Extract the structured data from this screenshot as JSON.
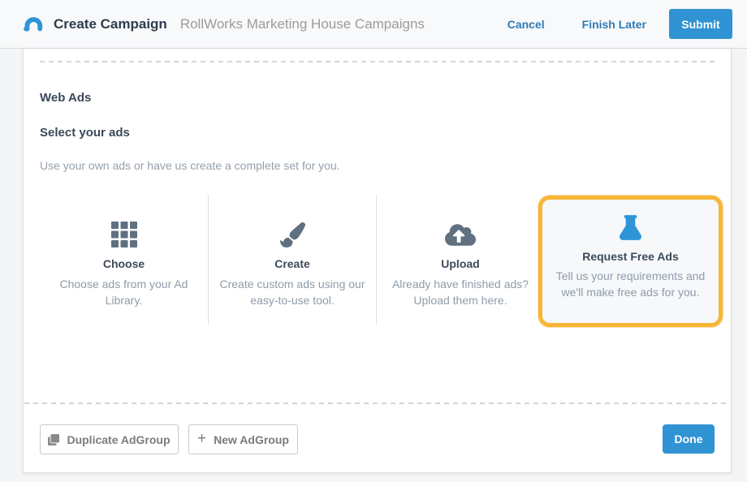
{
  "header": {
    "title": "Create Campaign",
    "subtitle": "RollWorks Marketing House Campaigns",
    "cancel_label": "Cancel",
    "finish_later_label": "Finish Later",
    "submit_label": "Submit"
  },
  "content": {
    "section_title": "Web Ads",
    "subsection_title": "Select your ads",
    "description": "Use your own ads or have us create a complete set for you.",
    "options": [
      {
        "icon": "grid-icon",
        "title": "Choose",
        "description": "Choose ads from your Ad Library.",
        "selected": false
      },
      {
        "icon": "paint-brush-icon",
        "title": "Create",
        "description": "Create custom ads using our easy-to-use tool.",
        "selected": false
      },
      {
        "icon": "cloud-upload-icon",
        "title": "Upload",
        "description": "Already have finished ads? Upload them here.",
        "selected": false
      },
      {
        "icon": "flask-icon",
        "title": "Request Free Ads",
        "description": "Tell us your requirements and we'll make free ads for you.",
        "selected": true
      }
    ]
  },
  "footer": {
    "duplicate_label": "Duplicate AdGroup",
    "new_label": "New AdGroup",
    "plus_glyph": "+",
    "done_label": "Done"
  },
  "icons": {
    "logo": "rollworks-swoosh-icon",
    "duplicate": "copy-icon",
    "new": "plus-icon"
  },
  "colors": {
    "accent_blue": "#3093d3",
    "link_blue": "#2d7cb7",
    "highlight_orange": "#f7b636",
    "icon_gray": "#5f7080",
    "flask_blue": "#2e95d8",
    "heading": "#3b4a5a",
    "muted_text": "#8e9caa",
    "header_bg": "#f8f9fa",
    "card_bg": "#ffffff",
    "selected_card_bg": "#f6f8fa"
  }
}
